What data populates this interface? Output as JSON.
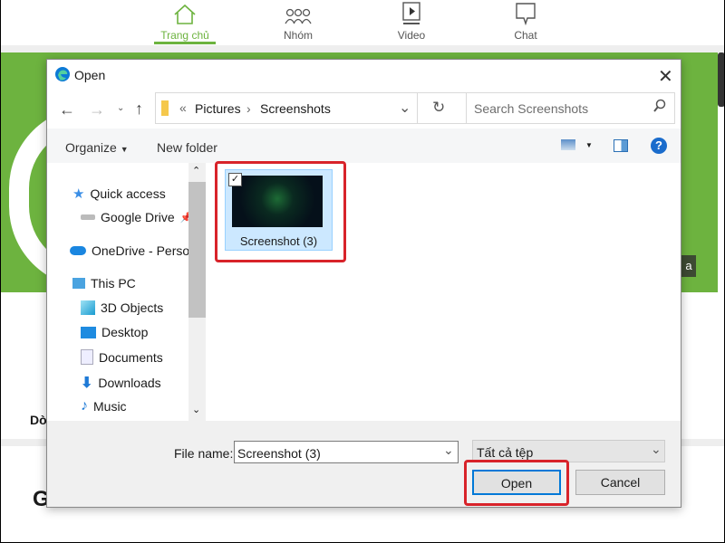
{
  "background_page": {
    "nav": [
      {
        "label": "Trang chủ",
        "icon": "home-icon",
        "active": true
      },
      {
        "label": "Nhóm",
        "icon": "group-icon"
      },
      {
        "label": "Video",
        "icon": "video-icon"
      },
      {
        "label": "Chat",
        "icon": "chat-icon"
      }
    ],
    "partial_text_1": "Dò",
    "partial_text_2": "G",
    "partial_badge": "a",
    "accent_color": "#6db33f"
  },
  "dialog": {
    "title": "Open",
    "breadcrumb": [
      "Pictures",
      "Screenshots"
    ],
    "breadcrumb_overflow": "«",
    "search_placeholder": "Search Screenshots",
    "toolbar": {
      "organize": "Organize",
      "new_folder": "New folder"
    },
    "nav_pane": [
      {
        "label": "Quick access",
        "icon": "star-icon"
      },
      {
        "label": "Google Drive",
        "icon": "drive-icon",
        "pinned": true
      },
      {
        "label": "OneDrive - Persor",
        "icon": "onedrive-icon"
      },
      {
        "label": "This PC",
        "icon": "computer-icon"
      },
      {
        "label": "3D Objects",
        "icon": "cube-icon"
      },
      {
        "label": "Desktop",
        "icon": "desktop-icon"
      },
      {
        "label": "Documents",
        "icon": "documents-icon"
      },
      {
        "label": "Downloads",
        "icon": "download-icon"
      },
      {
        "label": "Music",
        "icon": "music-icon"
      }
    ],
    "files": [
      {
        "name": "Screenshot (3)",
        "selected": true,
        "checked": true
      }
    ],
    "file_name_label": "File name:",
    "file_name_value": "Screenshot (3)",
    "file_type": "Tất cả tệp",
    "open_label": "Open",
    "cancel_label": "Cancel",
    "highlight_color": "#d8232a"
  }
}
